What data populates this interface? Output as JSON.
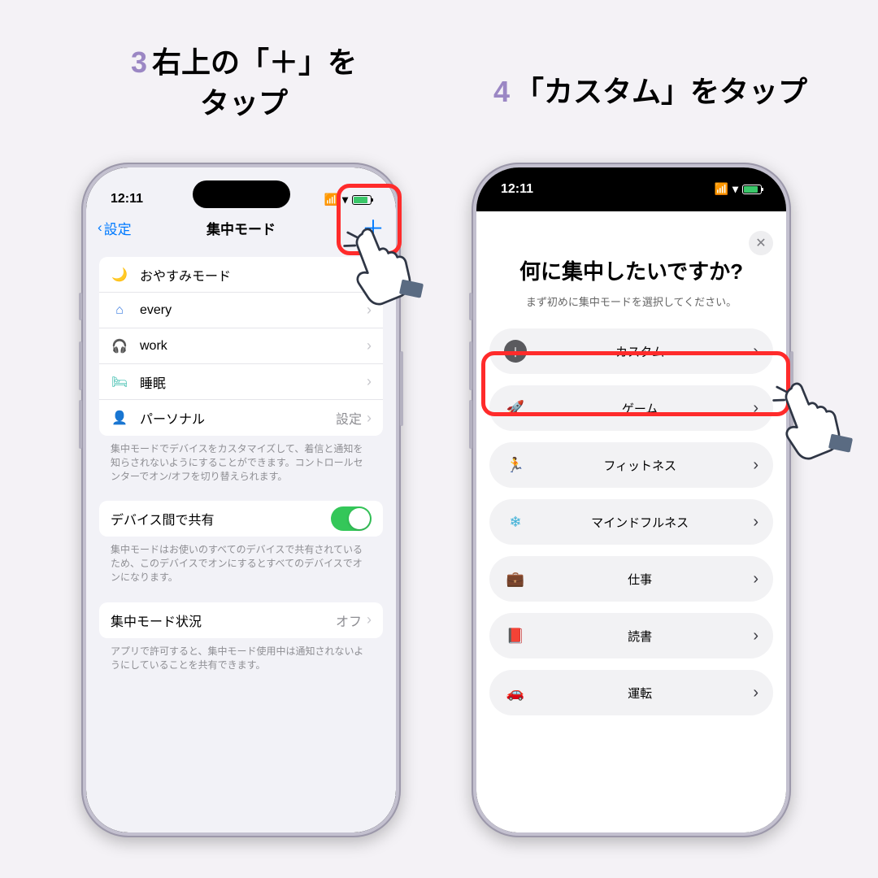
{
  "steps": {
    "three": {
      "num": "3",
      "text_line1": "右上の「＋」を",
      "text_line2": "タップ"
    },
    "four": {
      "num": "4",
      "text": "「カスタム」をタップ"
    }
  },
  "status": {
    "time": "12:11"
  },
  "screen1": {
    "nav_back": "設定",
    "nav_title": "集中モード",
    "modes": [
      {
        "icon": "🌙",
        "label": "おやすみモード",
        "accessory": "",
        "icon_class": "c-purple"
      },
      {
        "icon": "⌂",
        "label": "every",
        "accessory": "",
        "icon_class": "c-blue-home"
      },
      {
        "icon": "🎧",
        "label": "work",
        "accessory": "",
        "icon_class": "c-red"
      },
      {
        "icon": "🛏",
        "label": "睡眠",
        "accessory": "",
        "icon_class": "c-teal"
      },
      {
        "icon": "👤",
        "label": "パーソナル",
        "accessory": "設定",
        "icon_class": "c-purple"
      }
    ],
    "modes_footer": "集中モードでデバイスをカスタマイズして、着信と通知を知らされないようにすることができます。コントロールセンターでオン/オフを切り替えられます。",
    "share_label": "デバイス間で共有",
    "share_footer": "集中モードはお使いのすべてのデバイスで共有されているため、このデバイスでオンにするとすべてのデバイスでオンになります。",
    "status_label": "集中モード状況",
    "status_value": "オフ",
    "status_footer": "アプリで許可すると、集中モード使用中は通知されないようにしていることを共有できます。"
  },
  "screen2": {
    "title": "何に集中したいですか?",
    "subtitle": "まず初めに集中モードを選択してください。",
    "options": [
      {
        "icon": "＋",
        "label": "カスタム",
        "icon_class": "opt-custom-icon"
      },
      {
        "icon": "🚀",
        "label": "ゲーム",
        "icon_class": "c-darkblue"
      },
      {
        "icon": "🏃",
        "label": "フィットネス",
        "icon_class": "c-green"
      },
      {
        "icon": "❄",
        "label": "マインドフルネス",
        "icon_class": "c-cyan"
      },
      {
        "icon": "💼",
        "label": "仕事",
        "icon_class": "c-darkblue"
      },
      {
        "icon": "📕",
        "label": "読書",
        "icon_class": "c-orange"
      },
      {
        "icon": "🚗",
        "label": "運転",
        "icon_class": "c-navy"
      }
    ]
  }
}
